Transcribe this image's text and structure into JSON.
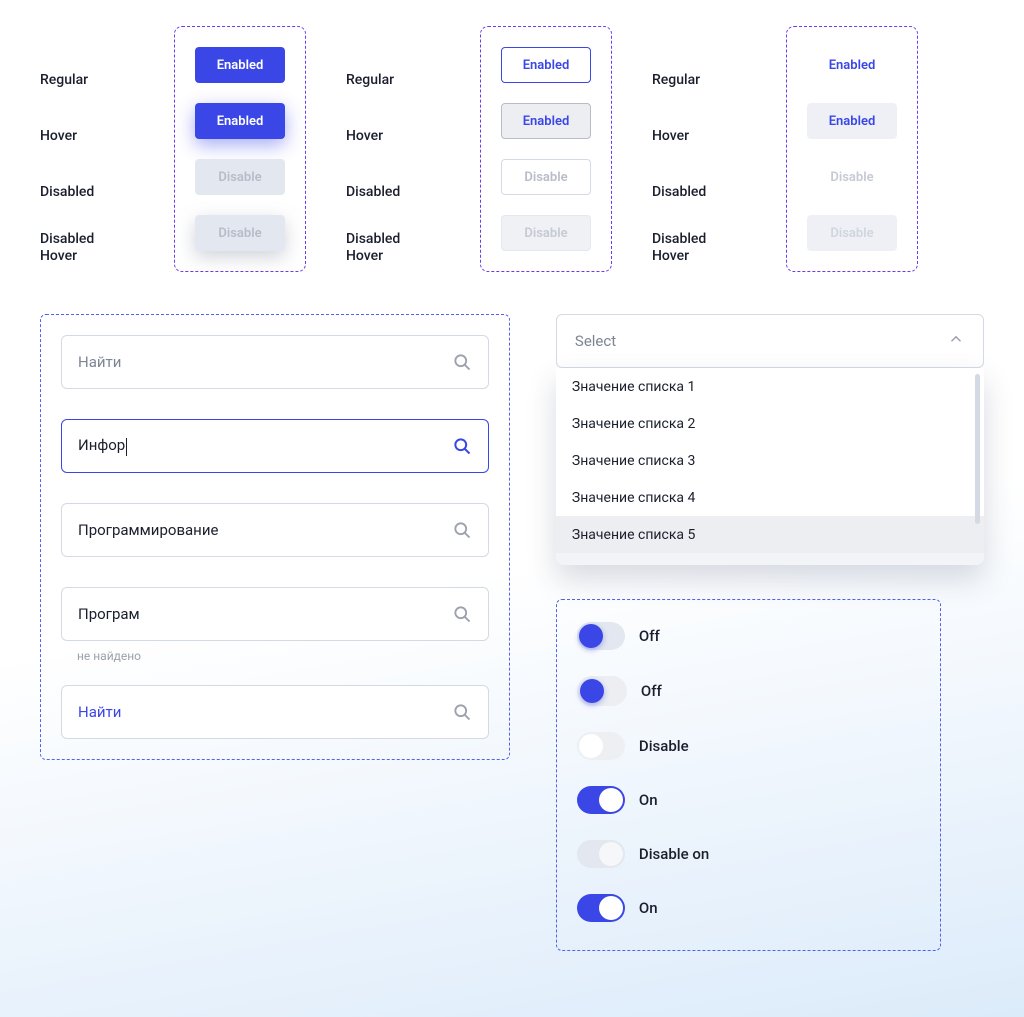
{
  "states": {
    "regular": "Regular",
    "hover": "Hover",
    "disabled": "Disabled",
    "disabled_hover_1": "Disabled",
    "disabled_hover_2": "Hover"
  },
  "btn": {
    "enabled": "Enabled",
    "disable": "Disable"
  },
  "search": {
    "placeholder": "Найти",
    "typing": "Инфор",
    "filled": "Программирование",
    "partial": "Програм",
    "not_found": "не найдено",
    "placeholder_blue": "Найти"
  },
  "select": {
    "placeholder": "Select",
    "options": [
      "Значение списка 1",
      "Значение списка 2",
      "Значение списка 3",
      "Значение списка 4",
      "Значение списка 5"
    ]
  },
  "toggles": {
    "off": "Off",
    "disable": "Disable",
    "on": "On",
    "disable_on": "Disable on"
  }
}
